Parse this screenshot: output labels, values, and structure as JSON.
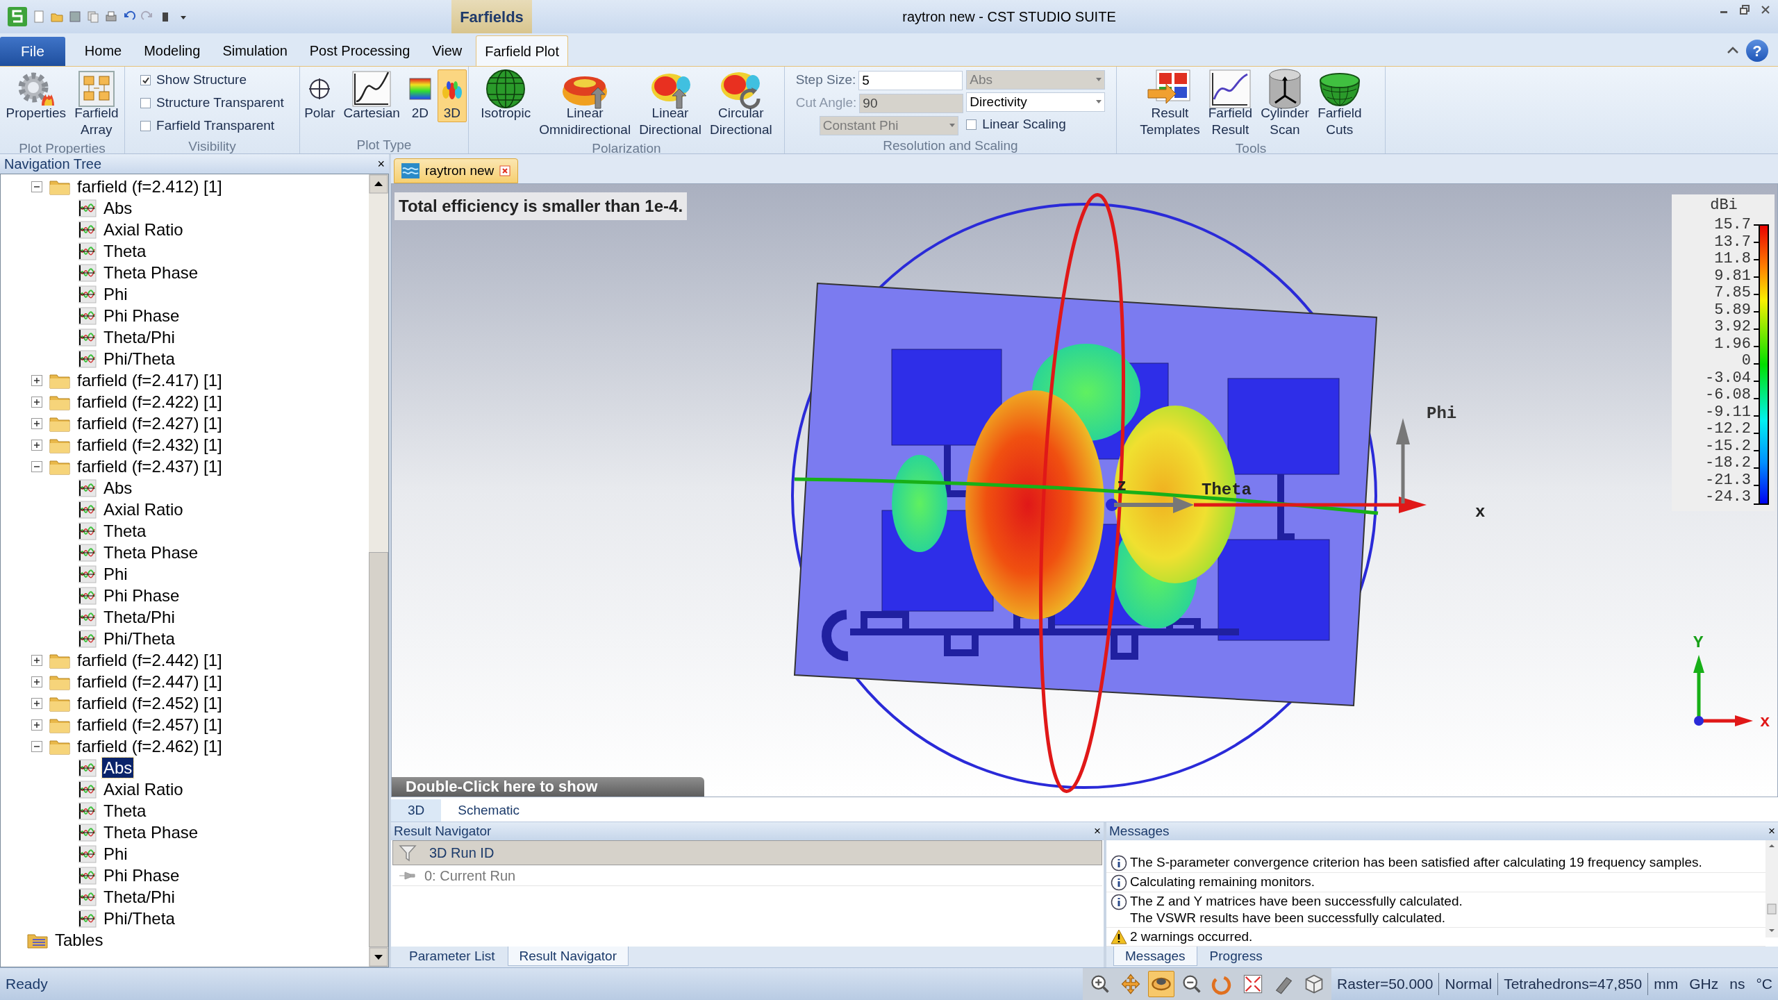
{
  "title_bar": {
    "context_tab": "Farfields",
    "title": "raytron new - CST STUDIO SUITE"
  },
  "menu_tabs": [
    {
      "label": "File",
      "kind": "file",
      "selected": false
    },
    {
      "label": "Home",
      "kind": "tab",
      "selected": false
    },
    {
      "label": "Modeling",
      "kind": "tab",
      "selected": false
    },
    {
      "label": "Simulation",
      "kind": "tab",
      "selected": false
    },
    {
      "label": "Post Processing",
      "kind": "tab",
      "selected": false
    },
    {
      "label": "View",
      "kind": "tab",
      "selected": false
    },
    {
      "label": "Farfield Plot",
      "kind": "tab",
      "selected": true
    }
  ],
  "help_button": "?",
  "ribbon": [
    {
      "label": "Plot Properties",
      "columns": [
        [
          {
            "kind": "large_button",
            "lines": [
              "Properties"
            ]
          }
        ],
        [
          {
            "kind": "large_button",
            "lines": [
              "Farfield",
              "Array"
            ]
          }
        ]
      ]
    },
    {
      "label": "Visibility",
      "columns": [
        [
          {
            "kind": "checkbox",
            "label": "Show Structure",
            "checked": true
          },
          {
            "kind": "checkbox",
            "label": "Structure Transparent",
            "checked": false
          },
          {
            "kind": "checkbox",
            "label": "Farfield Transparent",
            "checked": false
          }
        ]
      ]
    },
    {
      "label": "Plot Type",
      "columns": [
        [
          {
            "kind": "large_button",
            "lines": [
              "Polar"
            ],
            "selected": false
          }
        ],
        [
          {
            "kind": "large_button",
            "lines": [
              "Cartesian"
            ],
            "selected": false
          }
        ],
        [
          {
            "kind": "large_button",
            "lines": [
              "2D"
            ],
            "selected": false
          }
        ],
        [
          {
            "kind": "large_button",
            "lines": [
              "3D"
            ],
            "selected": true
          }
        ]
      ]
    },
    {
      "label": "Polarization",
      "columns": [
        [
          {
            "kind": "large_button",
            "lines": [
              "Isotropic"
            ]
          }
        ],
        [
          {
            "kind": "large_button",
            "lines": [
              "Linear",
              "Omnidirectional"
            ]
          }
        ],
        [
          {
            "kind": "large_button",
            "lines": [
              "Linear",
              "Directional"
            ]
          }
        ],
        [
          {
            "kind": "large_button",
            "lines": [
              "Circular",
              "Directional"
            ]
          }
        ]
      ]
    },
    {
      "label": "Resolution and Scaling",
      "columns": [
        [
          {
            "kind": "field",
            "label": "Step Size:",
            "value": "5",
            "disabled": false
          },
          {
            "kind": "field",
            "label": "Cut Angle:",
            "value": "90",
            "disabled": true
          },
          {
            "kind": "dropdown",
            "value": "Constant Phi",
            "disabled": true
          }
        ],
        [
          {
            "kind": "dropdown",
            "value": "Abs",
            "disabled": true
          },
          {
            "kind": "dropdown",
            "value": "Directivity",
            "disabled": false
          },
          {
            "kind": "checkbox",
            "label": "Linear Scaling",
            "checked": false
          }
        ]
      ]
    },
    {
      "label": "Tools",
      "columns": [
        [
          {
            "kind": "large_button",
            "lines": [
              "Result",
              "Templates"
            ]
          }
        ],
        [
          {
            "kind": "large_button",
            "lines": [
              "Farfield",
              "Result"
            ]
          }
        ],
        [
          {
            "kind": "large_button",
            "lines": [
              "Cylinder",
              "Scan"
            ]
          }
        ],
        [
          {
            "kind": "large_button",
            "lines": [
              "Farfield",
              "Cuts"
            ]
          }
        ]
      ]
    }
  ],
  "navigation_tree": {
    "title": "Navigation Tree",
    "close": "×",
    "items": [
      {
        "label": "farfield (f=2.412) [1]",
        "kind": "folder",
        "expanded": true,
        "selected": false,
        "children": [
          {
            "label": "Abs",
            "kind": "result",
            "selected": false
          },
          {
            "label": "Axial Ratio",
            "kind": "result",
            "selected": false
          },
          {
            "label": "Theta",
            "kind": "result",
            "selected": false
          },
          {
            "label": "Theta Phase",
            "kind": "result",
            "selected": false
          },
          {
            "label": "Phi",
            "kind": "result",
            "selected": false
          },
          {
            "label": "Phi Phase",
            "kind": "result",
            "selected": false
          },
          {
            "label": "Theta/Phi",
            "kind": "result",
            "selected": false
          },
          {
            "label": "Phi/Theta",
            "kind": "result",
            "selected": false
          }
        ]
      },
      {
        "label": "farfield (f=2.417) [1]",
        "kind": "folder",
        "expanded": false,
        "selected": false
      },
      {
        "label": "farfield (f=2.422) [1]",
        "kind": "folder",
        "expanded": false,
        "selected": false
      },
      {
        "label": "farfield (f=2.427) [1]",
        "kind": "folder",
        "expanded": false,
        "selected": false
      },
      {
        "label": "farfield (f=2.432) [1]",
        "kind": "folder",
        "expanded": false,
        "selected": false
      },
      {
        "label": "farfield (f=2.437) [1]",
        "kind": "folder",
        "expanded": true,
        "selected": false,
        "children": [
          {
            "label": "Abs",
            "kind": "result",
            "selected": false
          },
          {
            "label": "Axial Ratio",
            "kind": "result",
            "selected": false
          },
          {
            "label": "Theta",
            "kind": "result",
            "selected": false
          },
          {
            "label": "Theta Phase",
            "kind": "result",
            "selected": false
          },
          {
            "label": "Phi",
            "kind": "result",
            "selected": false
          },
          {
            "label": "Phi Phase",
            "kind": "result",
            "selected": false
          },
          {
            "label": "Theta/Phi",
            "kind": "result",
            "selected": false
          },
          {
            "label": "Phi/Theta",
            "kind": "result",
            "selected": false
          }
        ]
      },
      {
        "label": "farfield (f=2.442) [1]",
        "kind": "folder",
        "expanded": false,
        "selected": false
      },
      {
        "label": "farfield (f=2.447) [1]",
        "kind": "folder",
        "expanded": false,
        "selected": false
      },
      {
        "label": "farfield (f=2.452) [1]",
        "kind": "folder",
        "expanded": false,
        "selected": false
      },
      {
        "label": "farfield (f=2.457) [1]",
        "kind": "folder",
        "expanded": false,
        "selected": false
      },
      {
        "label": "farfield (f=2.462) [1]",
        "kind": "folder",
        "expanded": true,
        "selected": false,
        "children": [
          {
            "label": "Abs",
            "kind": "result",
            "selected": true
          },
          {
            "label": "Axial Ratio",
            "kind": "result",
            "selected": false
          },
          {
            "label": "Theta",
            "kind": "result",
            "selected": false
          },
          {
            "label": "Theta Phase",
            "kind": "result",
            "selected": false
          },
          {
            "label": "Phi",
            "kind": "result",
            "selected": false
          },
          {
            "label": "Phi Phase",
            "kind": "result",
            "selected": false
          },
          {
            "label": "Theta/Phi",
            "kind": "result",
            "selected": false
          },
          {
            "label": "Phi/Theta",
            "kind": "result",
            "selected": false
          }
        ]
      },
      {
        "label": "Tables",
        "kind": "tables",
        "selected": false
      }
    ]
  },
  "document_tab": {
    "label": "raytron new"
  },
  "view": {
    "notice": "Total efficiency is smaller than 1e-4.",
    "banner": "Double-Click here to show",
    "axis_labels": {
      "phi": "Phi",
      "theta": "Theta",
      "z": "z",
      "x": "x",
      "triad_y": "Y",
      "triad_x": "x"
    },
    "legend": {
      "unit": "dBi",
      "ticks": [
        "15.7",
        "13.7",
        "11.8",
        "9.81",
        "7.85",
        "5.89",
        "3.92",
        "1.96",
        "0",
        "-3.04",
        "-6.08",
        "-9.11",
        "-12.2",
        "-15.2",
        "-18.2",
        "-21.3",
        "-24.3"
      ]
    }
  },
  "view_tabs": [
    {
      "label": "3D",
      "selected": true
    },
    {
      "label": "Schematic",
      "selected": false
    }
  ],
  "result_navigator": {
    "title": "Result Navigator",
    "close": "×",
    "column": "3D Run ID",
    "rows": [
      "0: Current Run"
    ],
    "tabs": [
      {
        "label": "Parameter List",
        "selected": false
      },
      {
        "label": "Result Navigator",
        "selected": true
      }
    ]
  },
  "messages": {
    "title": "Messages",
    "close": "×",
    "items": [
      {
        "kind": "info",
        "lines": [
          "The S-parameter convergence criterion has been satisfied after calculating 19 frequency samples."
        ]
      },
      {
        "kind": "info",
        "lines": [
          "Calculating remaining monitors."
        ]
      },
      {
        "kind": "info",
        "lines": [
          "The Z and Y matrices have been successfully calculated.",
          "The VSWR results have been successfully calculated."
        ]
      },
      {
        "kind": "warning",
        "lines": [
          "2 warnings occurred."
        ]
      }
    ],
    "tabs": [
      {
        "label": "Messages",
        "selected": true
      },
      {
        "label": "Progress",
        "selected": false
      }
    ]
  },
  "status_bar": {
    "text": "Ready",
    "tools": [
      {
        "selected": false
      },
      {
        "selected": false
      },
      {
        "selected": true
      },
      {
        "selected": false
      },
      {
        "selected": false
      },
      {
        "selected": false
      },
      {
        "selected": false
      },
      {
        "selected": false
      }
    ],
    "fields": [
      "Raster=50.000",
      "Normal",
      "Tetrahedrons=47,850",
      "mm",
      "GHz",
      "ns",
      "°C"
    ]
  }
}
